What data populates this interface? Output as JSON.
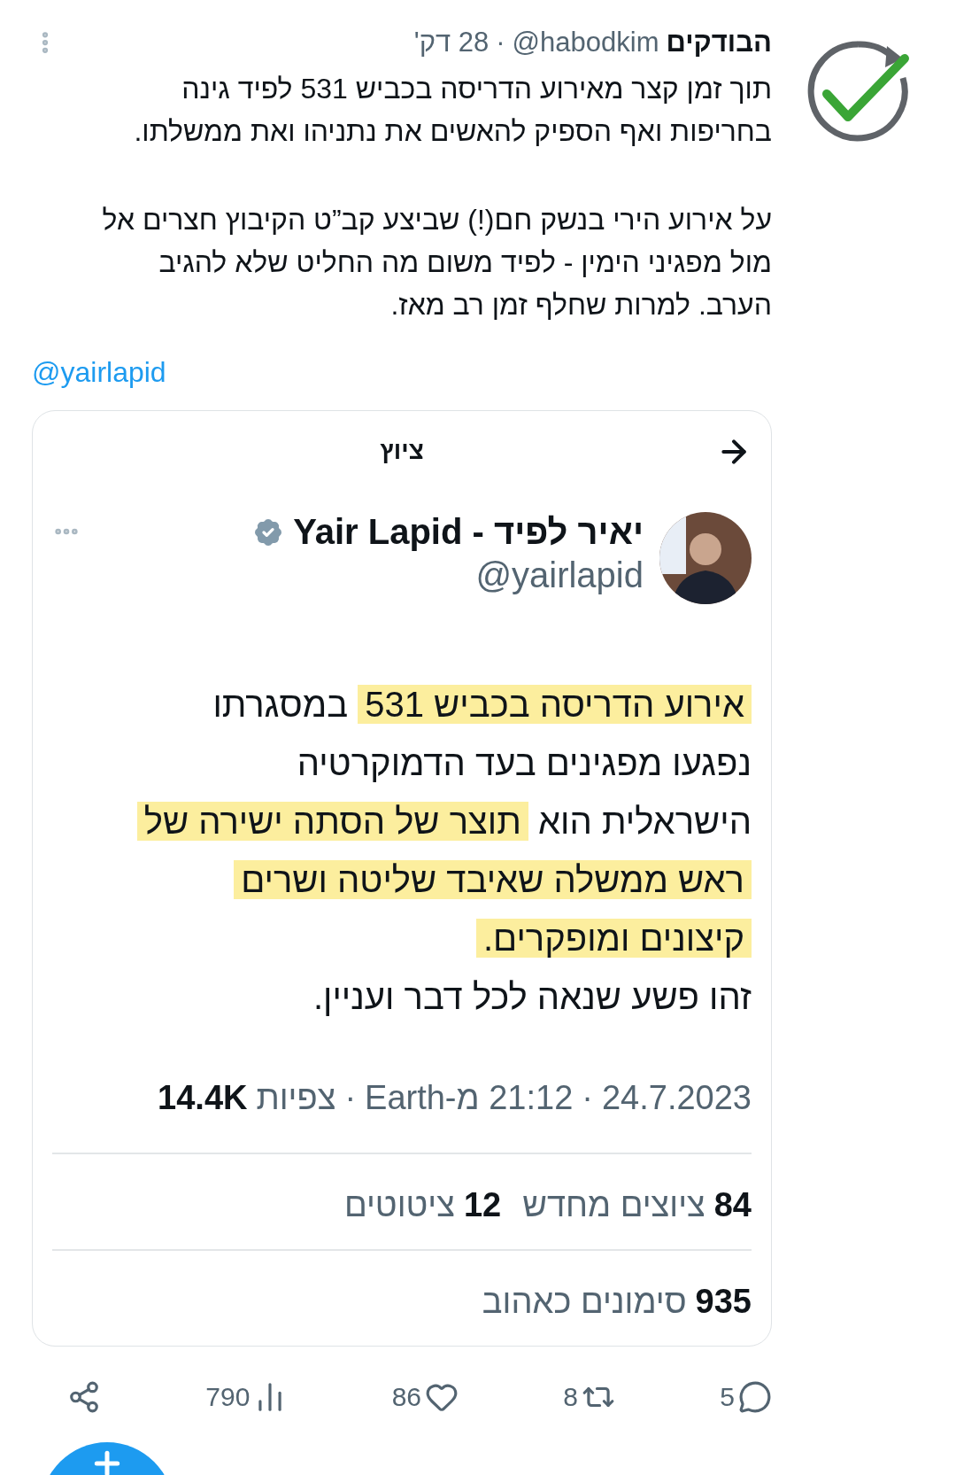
{
  "author": {
    "name": "הבודקים",
    "handle": "@habodkim",
    "separator": "·",
    "time": "28 דק'"
  },
  "text": [
    "תוך זמן קצר מאירוע הדריסה בכביש 531 לפיד גינה בחריפות ואף הספיק להאשים את נתניהו ואת ממשלתו.",
    "על אירוע הירי בנשק חם(!) שביצע קב”ט הקיבוץ חצרים אל מול מפגיני הימין - לפיד משום מה החליט שלא להגיב הערב. למרות שחלף זמן רב מאז."
  ],
  "mention": "@yairlapid",
  "quoted": {
    "header": "ציוץ",
    "author": {
      "name": "יאיר לפיד - Yair Lapid",
      "handle": "@yairlapid",
      "verified": true
    },
    "lines": [
      [
        {
          "text": "אירוע הדריסה בכביש 531",
          "highlighted": true
        },
        {
          "text": " במסגרתו",
          "highlighted": false
        }
      ],
      [
        {
          "text": "נפגעו מפגינים בעד הדמוקרטיה",
          "highlighted": false
        }
      ],
      [
        {
          "text": "הישראלית הוא ",
          "highlighted": false
        },
        {
          "text": "תוצר של הסתה ישירה של",
          "highlighted": true
        }
      ],
      [
        {
          "text": "ראש ממשלה שאיבד שליטה ושרים",
          "highlighted": true
        }
      ],
      [
        {
          "text": "קיצונים ומופקרים.",
          "highlighted": true
        }
      ],
      [
        {
          "text": "זהו פשע שנאה לכל דבר ועניין.",
          "highlighted": false
        }
      ]
    ],
    "meta": {
      "date": "24.7.2023",
      "time": "21:12 מ-Earth",
      "views_label": "צפיות",
      "views_count": "14.4K",
      "separator": "·"
    },
    "stats": [
      [
        {
          "count": "84",
          "label": "ציוצים מחדש"
        },
        {
          "count": "12",
          "label": "ציטוטים"
        }
      ],
      [
        {
          "count": "935",
          "label": "סימונים כאהוב"
        }
      ]
    ]
  },
  "actions": [
    {
      "kind": "reply",
      "count": "5"
    },
    {
      "kind": "retweet",
      "count": "8"
    },
    {
      "kind": "like",
      "count": "86"
    },
    {
      "kind": "views",
      "count": "790"
    },
    {
      "kind": "share"
    }
  ]
}
